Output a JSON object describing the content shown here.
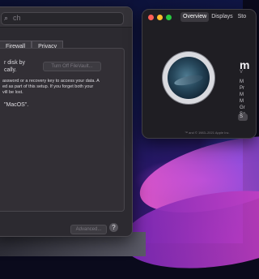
{
  "security_window": {
    "search": {
      "icon": "search-icon",
      "placeholder_fragment": "ch"
    },
    "tabs": [
      {
        "label": ""
      },
      {
        "label": "Firewall"
      },
      {
        "label": "Privacy"
      }
    ],
    "filevault": {
      "line1": "r disk by",
      "line2": "cally.",
      "button": "Turn Off FileVault...",
      "desc1": "assword or a recovery key to access your data. A",
      "desc2": "ed as part of this setup. If you forget both your",
      "desc3": "vill be lost.",
      "disk_label": "\"MacOS\"."
    },
    "advanced_button": "Advanced...",
    "help_button": "?"
  },
  "about_window": {
    "tabs": [
      "Overview",
      "Displays",
      "Sto"
    ],
    "selected_tab": "Overview",
    "name_fragment": "m",
    "version_fragment": "V",
    "spec_fragments": [
      "M",
      "Pr",
      "M",
      "M",
      "Gr",
      "Se"
    ],
    "button_fragment": "S",
    "footer": "™ and © 1983–2021 Apple Inc."
  }
}
